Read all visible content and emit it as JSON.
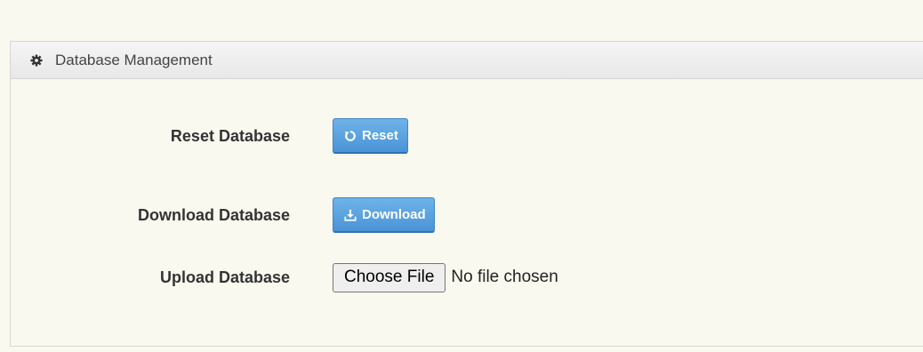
{
  "panel": {
    "title": "Database Management",
    "icon": "gear-icon"
  },
  "rows": {
    "reset": {
      "label": "Reset Database",
      "button_label": "Reset",
      "button_icon": "refresh-icon"
    },
    "download": {
      "label": "Download Database",
      "button_label": "Download",
      "button_icon": "download-icon"
    },
    "upload": {
      "label": "Upload Database",
      "choose_label": "Choose File",
      "status": "No file chosen"
    }
  },
  "colors": {
    "page_bg": "#f9f9ef",
    "button_blue": "#4a93d6"
  }
}
